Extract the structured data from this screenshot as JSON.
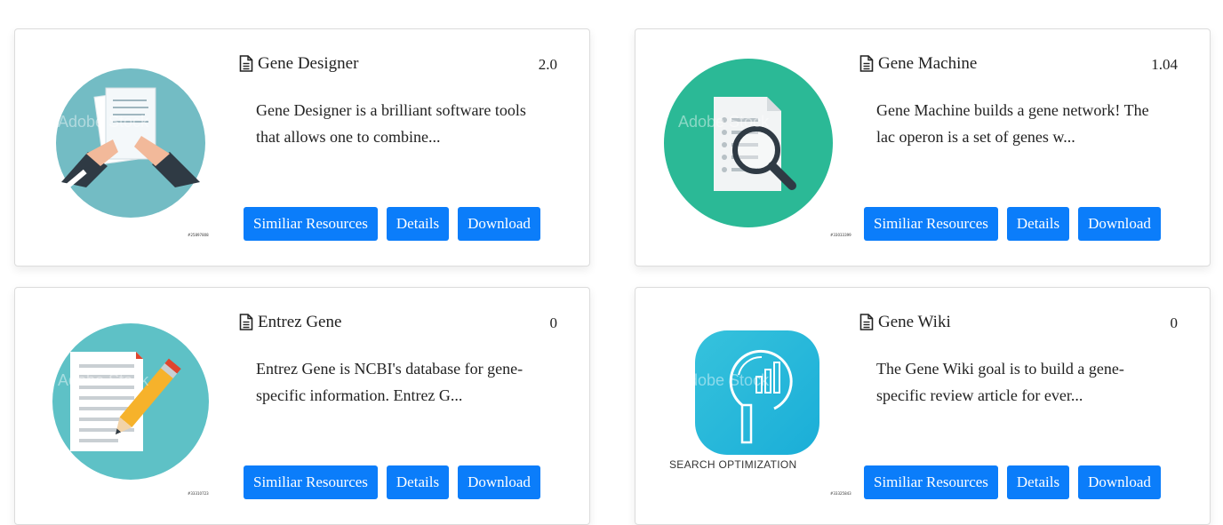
{
  "buttons": {
    "similar": "Similiar Resources",
    "details": "Details",
    "download": "Download"
  },
  "colors": {
    "primary": "#0b7dfa",
    "teal_card1": "#73bcc4",
    "green_card2": "#2bb996",
    "teal_card3": "#5ec1c6",
    "blue_card4": "#1aaed8"
  },
  "cards": [
    {
      "title": "Gene Designer",
      "version": "2.0",
      "description": "Gene Designer is a brilliant software tools that allows one to combine...",
      "stock_id": "#25897808",
      "image_icon": "documents-hands-icon"
    },
    {
      "title": "Gene Machine",
      "version": "1.04",
      "description": "Gene Machine builds a gene network! The lac operon is a set of genes w...",
      "stock_id": "#33033399",
      "image_icon": "document-magnifier-icon"
    },
    {
      "title": "Entrez Gene",
      "version": "0",
      "description": "Entrez Gene is NCBI's database for gene-specific information. Entrez G...",
      "stock_id": "#33310723",
      "image_icon": "document-pencil-icon"
    },
    {
      "title": "Gene Wiki",
      "version": "0",
      "description": "The Gene Wiki goal is to build a gene-specific review article for ever...",
      "stock_id": "#33325843",
      "image_icon": "search-optimization-icon",
      "image_caption": "SEARCH OPTIMIZATION"
    }
  ],
  "watermark": "Adobe Stock"
}
